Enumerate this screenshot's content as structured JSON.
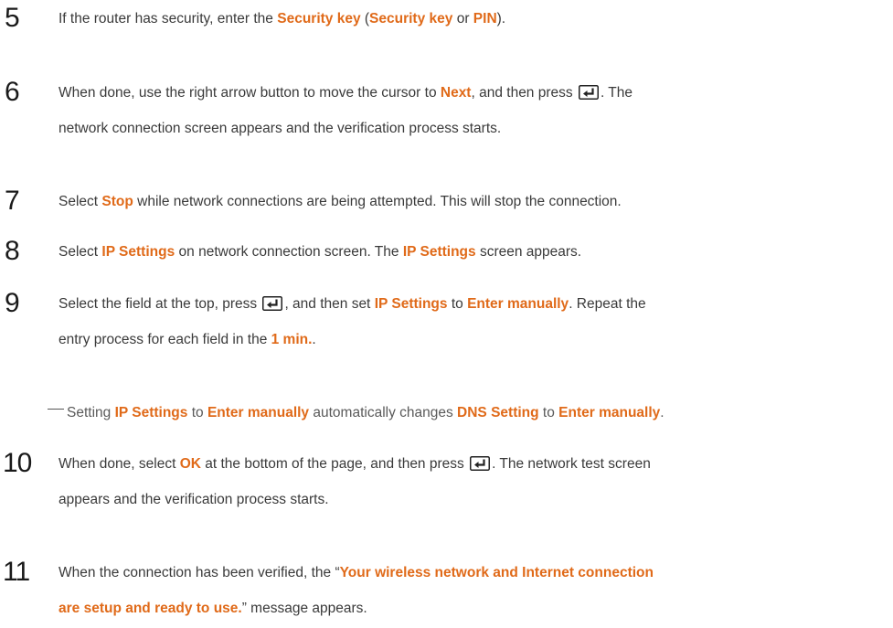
{
  "icons": {
    "enter": "enter-key-icon"
  },
  "steps": [
    {
      "number": "5",
      "t1": "If the router has security, enter the ",
      "h1": "Security key",
      "t2": " (",
      "h2": "Security key",
      "t3": " or ",
      "h3": "PIN",
      "t4": ")."
    },
    {
      "number": "6",
      "t1": "When done, use the right arrow button to move the cursor to ",
      "h1": "Next",
      "t2": ", and then press ",
      "t3": ". The",
      "t4": "network connection screen appears and the verification process starts."
    },
    {
      "number": "7",
      "t1": "Select ",
      "h1": "Stop",
      "t2": " while network connections are being attempted. This will stop the connection."
    },
    {
      "number": "8",
      "t1": "Select ",
      "h1": "IP Settings",
      "t2": " on network connection screen. The ",
      "h2": "IP Settings",
      "t3": " screen appears."
    },
    {
      "number": "9",
      "t1": "Select the field at the top, press ",
      "t2": ", and then set ",
      "h1": "IP Settings",
      "t3": " to ",
      "h2": "Enter manually",
      "t4": ". Repeat the",
      "t5": "entry process for each field in the ",
      "h3": "1 min.",
      "t6": "."
    },
    {
      "number": "10",
      "t1": "When done, select ",
      "h1": "OK",
      "t2": " at the bottom of the page, and then press ",
      "t3": ". The network test screen",
      "t4": "appears and the verification process starts."
    },
    {
      "number": "11",
      "t1": "When the connection has been verified, the “",
      "h1": "Your wireless network and Internet connection",
      "h2": "are setup and ready to use.",
      "t2": "” message appears."
    }
  ],
  "note": {
    "t1": "Setting ",
    "h1": "IP Settings",
    "t2": " to ",
    "h2": "Enter manually",
    "t3": " automatically changes ",
    "h3": "DNS Setting",
    "t4": " to ",
    "h4": "Enter manually",
    "t5": "."
  }
}
